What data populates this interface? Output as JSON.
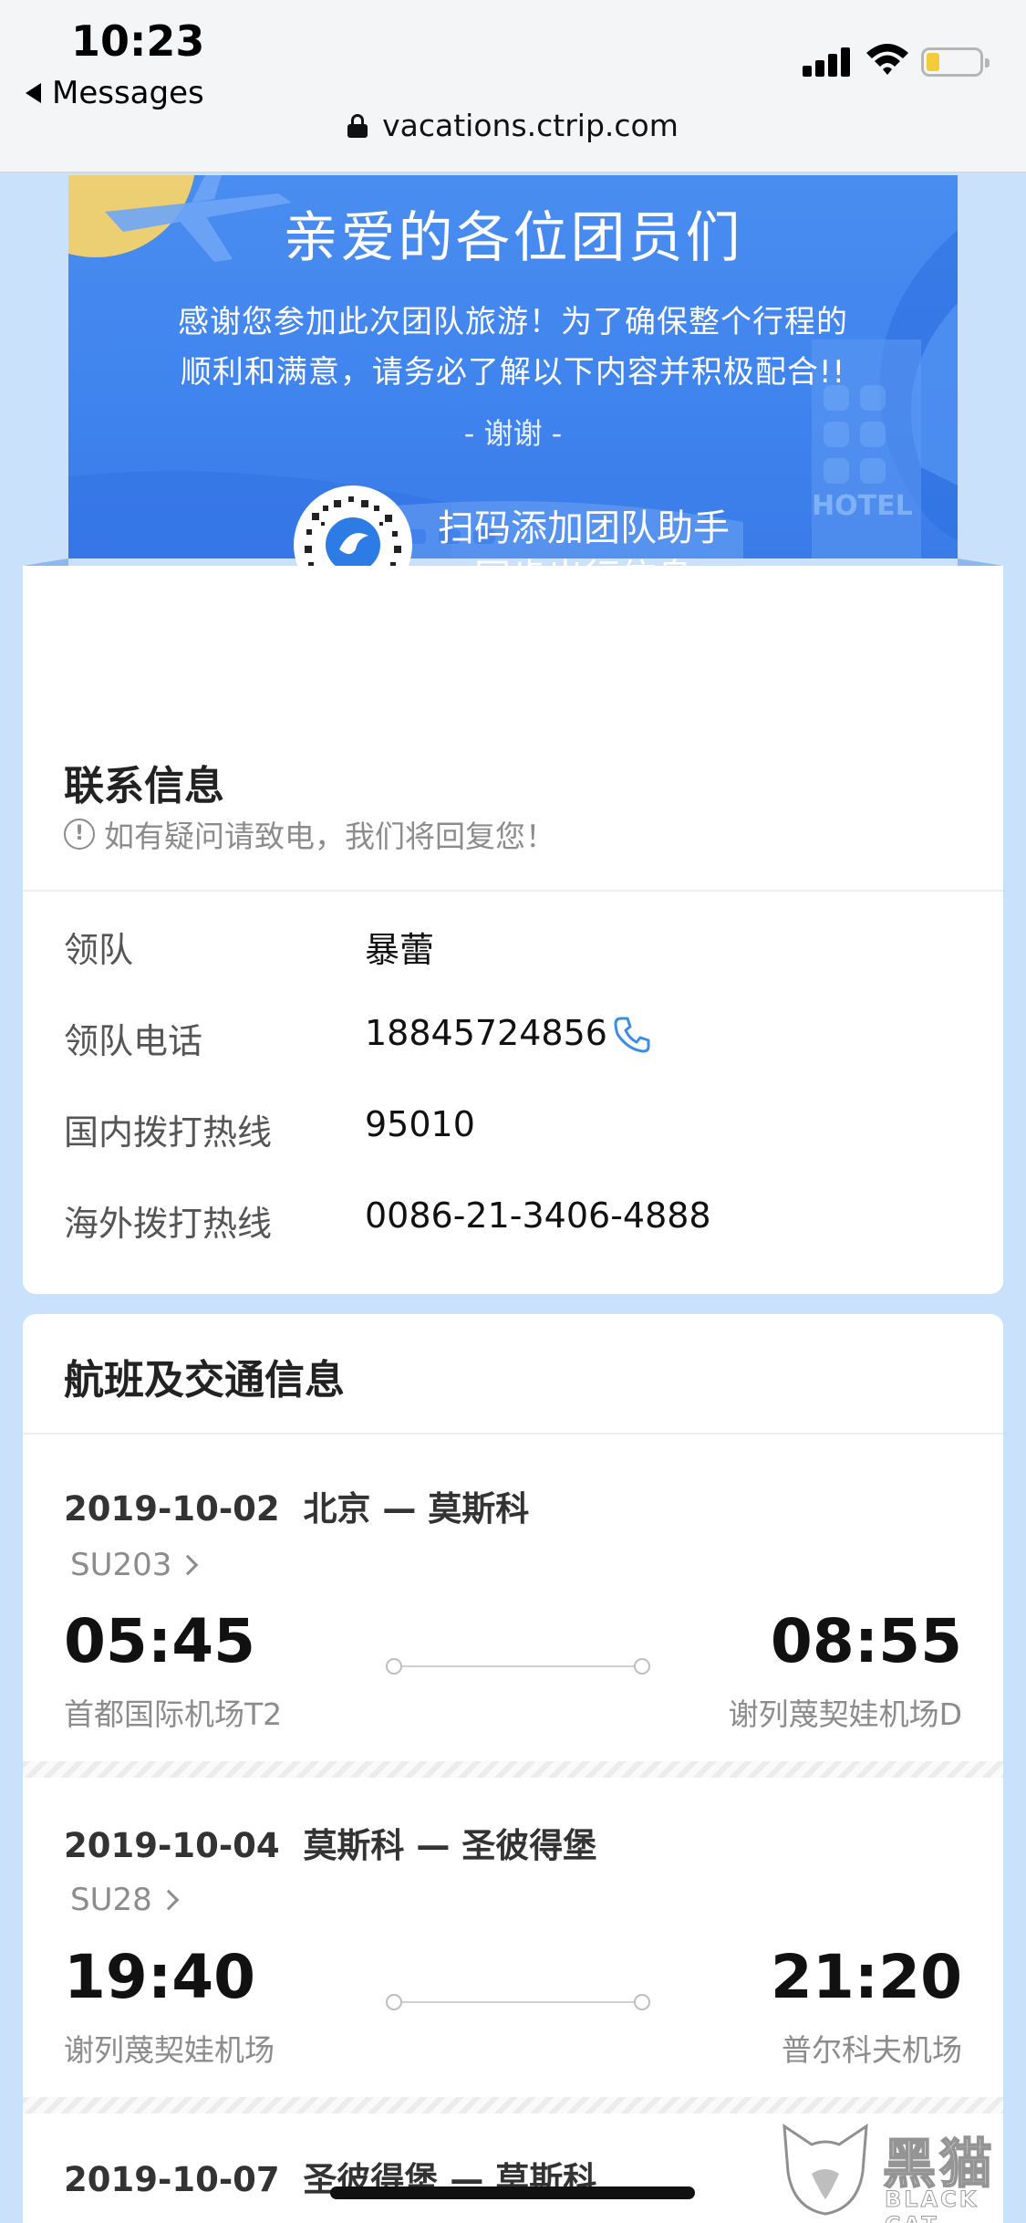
{
  "status_bar": {
    "time": "10:23",
    "back_app": "Messages",
    "url": "vacations.ctrip.com"
  },
  "banner": {
    "title": "亲爱的各位团员们",
    "line1": "感谢您参加此次团队旅游！为了确保整个行程的",
    "line2": "顺利和满意，请务必了解以下内容并积极配合!!",
    "thanks": "- 谢谢 -",
    "qr_line1": "扫码添加团队助手",
    "qr_line2": "同步出行信息",
    "hotel_sign": "HOTEL"
  },
  "contact": {
    "title": "联系信息",
    "notice": "如有疑问请致电，我们将回复您！",
    "rows": [
      {
        "label": "领队",
        "value": "暴蕾"
      },
      {
        "label": "领队电话",
        "value": "18845724856"
      },
      {
        "label": "国内拨打热线",
        "value": "95010"
      },
      {
        "label": "海外拨打热线",
        "value": "0086-21-3406-4888"
      }
    ]
  },
  "flights": {
    "title": "航班及交通信息",
    "items": [
      {
        "date": "2019-10-02",
        "route": "北京 — 莫斯科",
        "flight_no": "SU203",
        "dep_time": "05:45",
        "arr_time": "08:55",
        "dep_airport": "首都国际机场T2",
        "arr_airport": "谢列蔑契娃机场D"
      },
      {
        "date": "2019-10-04",
        "route": "莫斯科 — 圣彼得堡",
        "flight_no": "SU28",
        "dep_time": "19:40",
        "arr_time": "21:20",
        "dep_airport": "谢列蔑契娃机场",
        "arr_airport": "普尔科夫机场"
      },
      {
        "date": "2019-10-07",
        "route": "圣彼得堡 — 莫斯科"
      }
    ]
  },
  "watermark": {
    "cn": "黑猫",
    "en": "BLACK CAT"
  },
  "colors": {
    "banner_blue": "#4a8df0",
    "page_bg": "#c9e1fa",
    "phone_blue": "#3b8de6"
  }
}
